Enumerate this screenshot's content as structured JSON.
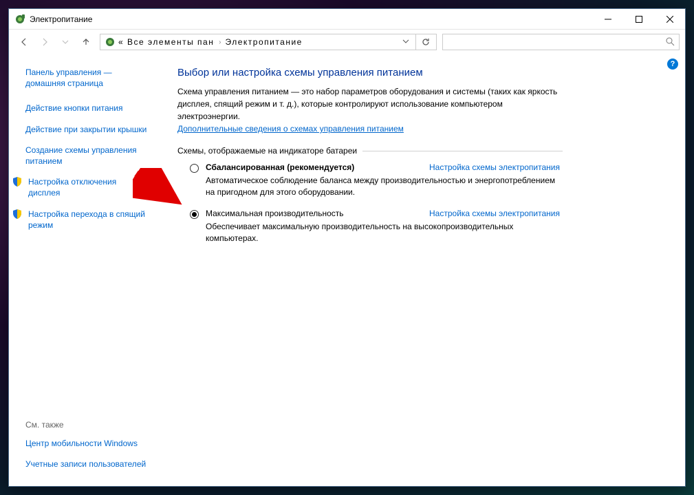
{
  "window": {
    "title": "Электропитание"
  },
  "address": {
    "part1": "« Все элементы панели упра ...",
    "part2": "Электропитание"
  },
  "sidebar": {
    "home": "Панель управления — домашняя страница",
    "links": [
      "Действие кнопки питания",
      "Действие при закрытии крышки",
      "Создание схемы управления питанием",
      "Настройка отключения дисплея",
      "Настройка перехода в спящий режим"
    ],
    "footer_label": "См. также",
    "footer_links": [
      "Центр мобильности Windows",
      "Учетные записи пользователей"
    ]
  },
  "main": {
    "heading": "Выбор или настройка схемы управления питанием",
    "description": "Схема управления питанием — это набор параметров оборудования и системы (таких как яркость дисплея, спящий режим и т. д.), которые контролируют использование компьютером электроэнергии.",
    "more_link": "Дополнительные сведения о схемах управления питанием",
    "fieldset_legend": "Схемы, отображаемые на индикаторе батареи",
    "plans": [
      {
        "name": "Сбалансированная (рекомендуется)",
        "link": "Настройка схемы электропитания",
        "desc": "Автоматическое соблюдение баланса между производительностью и энергопотреблением на пригодном для этого оборудовании.",
        "checked": false
      },
      {
        "name": "Максимальная производительность",
        "link": "Настройка схемы электропитания",
        "desc": "Обеспечивает максимальную производительность на высокопроизводительных компьютерах.",
        "checked": true
      }
    ]
  }
}
